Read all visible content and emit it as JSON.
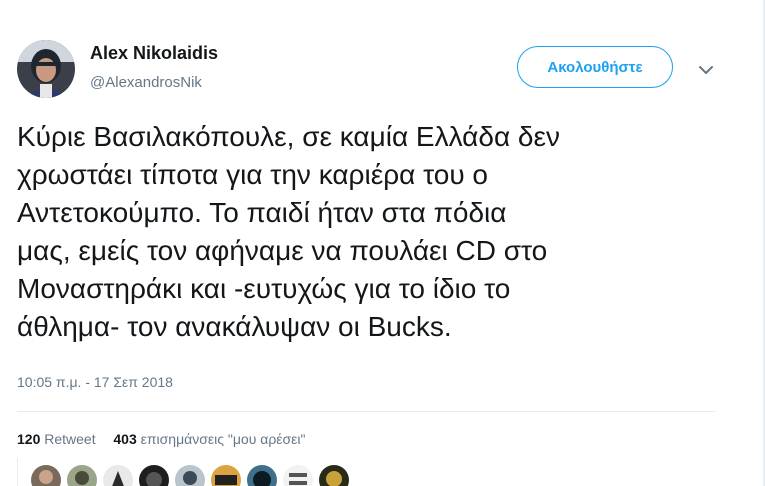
{
  "user": {
    "name": "Alex Nikolaidis",
    "handle": "@AlexandrosNik"
  },
  "follow_button": {
    "label": "Ακολουθήστε"
  },
  "menu_icon": "chevron-down-icon",
  "tweet": {
    "lines": [
      "Κύριε Βασιλακόπουλε, σε καμία Ελλάδα δεν",
      "χρωστάει τίποτα για την καριέρα του ο",
      "Αντετοκούμπο. Το παιδί ήταν στα πόδια",
      "μας, εμείς τον αφήναμε να πουλάει CD στο",
      "Μοναστηράκι και -ευτυχώς για το ίδιο το",
      "άθλημα- τον ανακάλυψαν οι Bucks."
    ],
    "timestamp": "10:05 π.μ. - 17 Σεπ 2018"
  },
  "stats": {
    "retweets_count": "120",
    "retweets_label": "Retweet",
    "likes_count": "403",
    "likes_label": "επισημάνσεις \"μου αρέσει\""
  },
  "colors": {
    "accent": "#1da1f2",
    "text": "#14171a",
    "muted": "#657786",
    "divider": "#e6ecf0"
  }
}
